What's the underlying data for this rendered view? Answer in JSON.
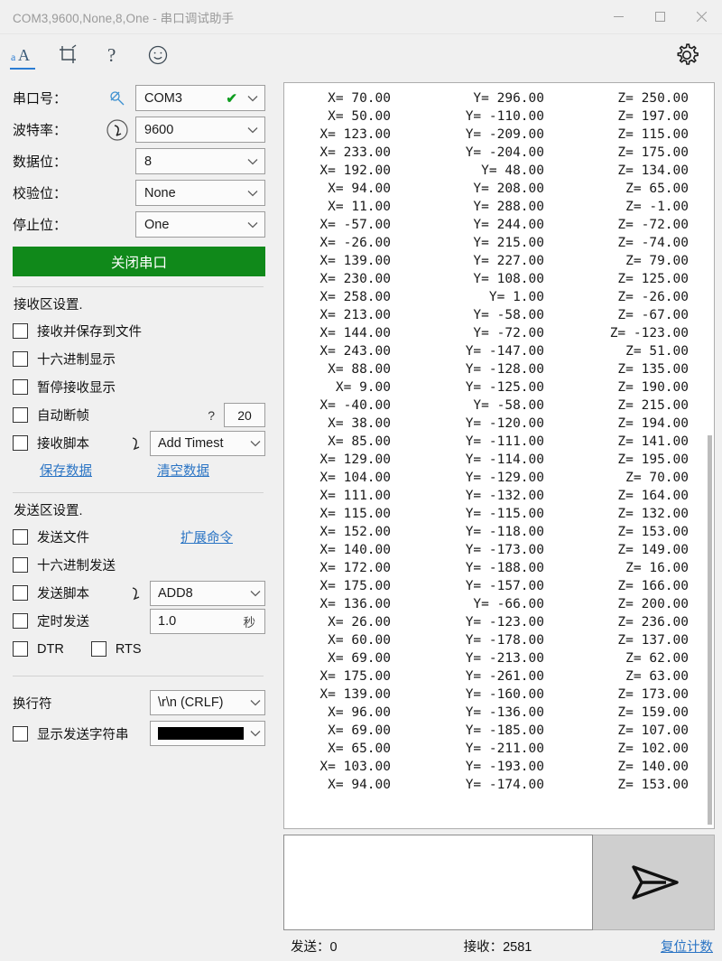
{
  "window": {
    "title": "COM3,9600,None,8,One - 串口调试助手",
    "minimize_label": "最小化",
    "maximize_label": "最大化",
    "close_label": "关闭"
  },
  "toolbar": {
    "items": [
      {
        "name": "font-icon",
        "label": "aA"
      },
      {
        "name": "crop-icon",
        "label": "裁剪"
      },
      {
        "name": "help-icon",
        "label": "?"
      },
      {
        "name": "smiley-icon",
        "label": "表情"
      }
    ],
    "settings_label": "设置"
  },
  "sidebar": {
    "port": {
      "label": "串口号：",
      "value": "COM3",
      "status": "✔"
    },
    "baud": {
      "label": "波特率：",
      "value": "9600"
    },
    "databits": {
      "label": "数据位：",
      "value": "8"
    },
    "parity": {
      "label": "校验位：",
      "value": "None"
    },
    "stopbits": {
      "label": "停止位：",
      "value": "One"
    },
    "toggle_button": "关闭串口",
    "receive_section": {
      "title": "接收区设置.",
      "save_to_file": "接收并保存到文件",
      "hex_display": "十六进制显示",
      "pause_display": "暂停接收显示",
      "auto_break": "自动断帧",
      "auto_break_help": "?",
      "auto_break_value": "20",
      "recv_script": "接收脚本",
      "recv_script_value": "Add Timest",
      "save_data_link": "保存数据",
      "clear_data_link": "清空数据"
    },
    "send_section": {
      "title": "发送区设置.",
      "send_file": "发送文件",
      "extend_cmd_link": "扩展命令",
      "hex_send": "十六进制发送",
      "send_script": "发送脚本",
      "send_script_value": "ADD8",
      "timed_send": "定时发送",
      "timed_send_value": "1.0",
      "timed_send_unit": "秒",
      "dtr": "DTR",
      "rts": "RTS"
    },
    "newline": {
      "label": "换行符",
      "value": "\\r\\n (CRLF)"
    },
    "show_send_string": {
      "label": "显示发送字符串",
      "color": "#000000"
    }
  },
  "receive": {
    "lines": [
      {
        "x": "X= 70.00",
        "y": "Y= 296.00",
        "z": "Z= 250.00"
      },
      {
        "x": "X= 50.00",
        "y": "Y= -110.00",
        "z": "Z= 197.00"
      },
      {
        "x": "X= 123.00",
        "y": "Y= -209.00",
        "z": "Z= 115.00"
      },
      {
        "x": "X= 233.00",
        "y": "Y= -204.00",
        "z": "Z= 175.00"
      },
      {
        "x": "X= 192.00",
        "y": "Y= 48.00",
        "z": "Z= 134.00"
      },
      {
        "x": "X= 94.00",
        "y": "Y= 208.00",
        "z": "Z= 65.00"
      },
      {
        "x": "X= 11.00",
        "y": "Y= 288.00",
        "z": "Z= -1.00"
      },
      {
        "x": "X= -57.00",
        "y": "Y= 244.00",
        "z": "Z= -72.00"
      },
      {
        "x": "X= -26.00",
        "y": "Y= 215.00",
        "z": "Z= -74.00"
      },
      {
        "x": "X= 139.00",
        "y": "Y= 227.00",
        "z": "Z= 79.00"
      },
      {
        "x": "X= 230.00",
        "y": "Y= 108.00",
        "z": "Z= 125.00"
      },
      {
        "x": "X= 258.00",
        "y": "Y= 1.00",
        "z": "Z= -26.00"
      },
      {
        "x": "X= 213.00",
        "y": "Y= -58.00",
        "z": "Z= -67.00"
      },
      {
        "x": "X= 144.00",
        "y": "Y= -72.00",
        "z": "Z= -123.00"
      },
      {
        "x": "X= 243.00",
        "y": "Y= -147.00",
        "z": "Z= 51.00"
      },
      {
        "x": "X= 88.00",
        "y": "Y= -128.00",
        "z": "Z= 135.00"
      },
      {
        "x": "X= 9.00",
        "y": "Y= -125.00",
        "z": "Z= 190.00"
      },
      {
        "x": "X= -40.00",
        "y": "Y= -58.00",
        "z": "Z= 215.00"
      },
      {
        "x": "X= 38.00",
        "y": "Y= -120.00",
        "z": "Z= 194.00"
      },
      {
        "x": "X= 85.00",
        "y": "Y= -111.00",
        "z": "Z= 141.00"
      },
      {
        "x": "X= 129.00",
        "y": "Y= -114.00",
        "z": "Z= 195.00"
      },
      {
        "x": "X= 104.00",
        "y": "Y= -129.00",
        "z": "Z= 70.00"
      },
      {
        "x": "X= 111.00",
        "y": "Y= -132.00",
        "z": "Z= 164.00"
      },
      {
        "x": "X= 115.00",
        "y": "Y= -115.00",
        "z": "Z= 132.00"
      },
      {
        "x": "X= 152.00",
        "y": "Y= -118.00",
        "z": "Z= 153.00"
      },
      {
        "x": "X= 140.00",
        "y": "Y= -173.00",
        "z": "Z= 149.00"
      },
      {
        "x": "X= 172.00",
        "y": "Y= -188.00",
        "z": "Z= 16.00"
      },
      {
        "x": "X= 175.00",
        "y": "Y= -157.00",
        "z": "Z= 166.00"
      },
      {
        "x": "X= 136.00",
        "y": "Y= -66.00",
        "z": "Z= 200.00"
      },
      {
        "x": "X= 26.00",
        "y": "Y= -123.00",
        "z": "Z= 236.00"
      },
      {
        "x": "X= 60.00",
        "y": "Y= -178.00",
        "z": "Z= 137.00"
      },
      {
        "x": "X= 69.00",
        "y": "Y= -213.00",
        "z": "Z= 62.00"
      },
      {
        "x": "X= 175.00",
        "y": "Y= -261.00",
        "z": "Z= 63.00"
      },
      {
        "x": "X= 139.00",
        "y": "Y= -160.00",
        "z": "Z= 173.00"
      },
      {
        "x": "X= 96.00",
        "y": "Y= -136.00",
        "z": "Z= 159.00"
      },
      {
        "x": "X= 69.00",
        "y": "Y= -185.00",
        "z": "Z= 107.00"
      },
      {
        "x": "X= 65.00",
        "y": "Y= -211.00",
        "z": "Z= 102.00"
      },
      {
        "x": "X= 103.00",
        "y": "Y= -193.00",
        "z": "Z= 140.00"
      },
      {
        "x": "X= 94.00",
        "y": "Y= -174.00",
        "z": "Z= 153.00"
      }
    ]
  },
  "send_area": {
    "input_value": "",
    "send_button_label": "发送"
  },
  "status": {
    "sent": "发送：0",
    "received": "接收：2581",
    "reset_link": "复位计数"
  }
}
